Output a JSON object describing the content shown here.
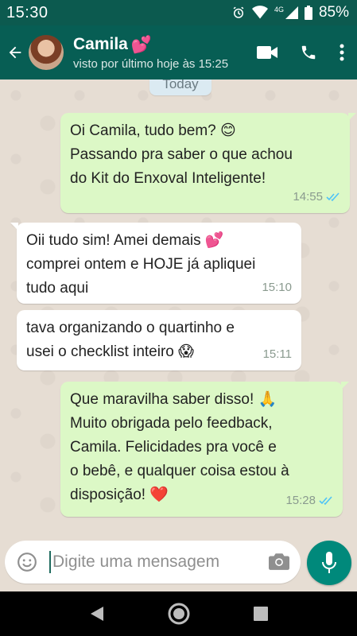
{
  "status_bar": {
    "time": "15:30",
    "network": "4G",
    "battery": "85%"
  },
  "header": {
    "contact_name": "Camila",
    "name_emoji": "💕",
    "last_seen": "visto por último hoje às 15:25",
    "icons": [
      "back-arrow-icon",
      "video-call-icon",
      "phone-icon",
      "more-vert-icon"
    ]
  },
  "chat": {
    "date_label": "Today",
    "messages": [
      {
        "direction": "out",
        "lines": [
          "Oi Camila, tudo bem? 😊",
          "Passando pra saber o que achou",
          "do Kit do Enxoval Inteligente!"
        ],
        "time": "14:55",
        "read": true
      },
      {
        "direction": "in",
        "lines": [
          "Oii tudo sim! Amei demais 💕",
          "comprei ontem e HOJE já apliquei",
          "tudo aqui"
        ],
        "time": "15:10"
      },
      {
        "direction": "in",
        "lines": [
          "tava organizando o quartinho e",
          "usei o checklist inteiro 😱"
        ],
        "time": "15:11"
      },
      {
        "direction": "out",
        "lines": [
          "Que maravilha saber disso! 🙏",
          "Muito obrigada pelo feedback,",
          "Camila. Felicidades pra você e",
          "o bebê, e qualquer coisa estou à",
          "disposição! ❤️"
        ],
        "time": "15:28",
        "read": true
      }
    ]
  },
  "composer": {
    "placeholder": "Digite uma mensagem"
  },
  "colors": {
    "header": "#075e54",
    "status_bar": "#0c5a4f",
    "outgoing_bubble": "#dcf8c6",
    "incoming_bubble": "#ffffff",
    "read_tick": "#4fc3f7",
    "accent": "#00897b"
  }
}
